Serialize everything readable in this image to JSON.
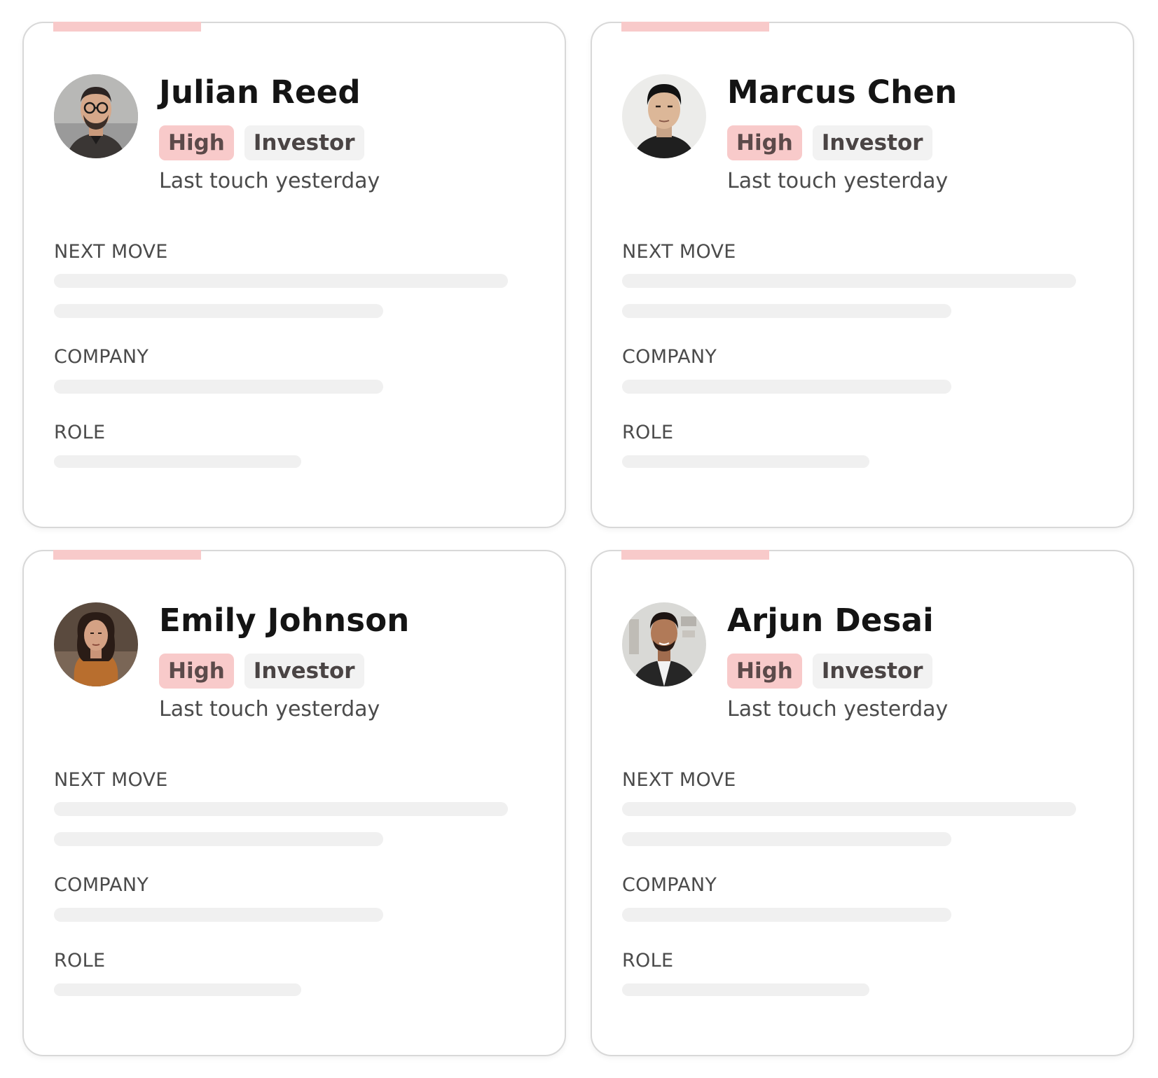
{
  "contacts": [
    {
      "name": "Julian Reed",
      "priority": "High",
      "type": "Investor",
      "last_touch": "Last touch yesterday",
      "labels": {
        "next_move": "NEXT MOVE",
        "company": "COMPANY",
        "role": "ROLE"
      }
    },
    {
      "name": "Marcus Chen",
      "priority": "High",
      "type": "Investor",
      "last_touch": "Last touch yesterday",
      "labels": {
        "next_move": "NEXT MOVE",
        "company": "COMPANY",
        "role": "ROLE"
      }
    },
    {
      "name": "Emily Johnson",
      "priority": "High",
      "type": "Investor",
      "last_touch": "Last touch yesterday",
      "labels": {
        "next_move": "NEXT MOVE",
        "company": "COMPANY",
        "role": "ROLE"
      }
    },
    {
      "name": "Arjun Desai",
      "priority": "High",
      "type": "Investor",
      "last_touch": "Last touch yesterday",
      "labels": {
        "next_move": "NEXT MOVE",
        "company": "COMPANY",
        "role": "ROLE"
      }
    }
  ],
  "colors": {
    "accent": "#f8caca",
    "priority_tag_bg": "#f8caca",
    "type_tag_bg": "#f2f2f2",
    "skeleton": "#f0f0f0",
    "card_border": "#d8d8d8"
  },
  "icons": {
    "avatar": "person-photo"
  }
}
